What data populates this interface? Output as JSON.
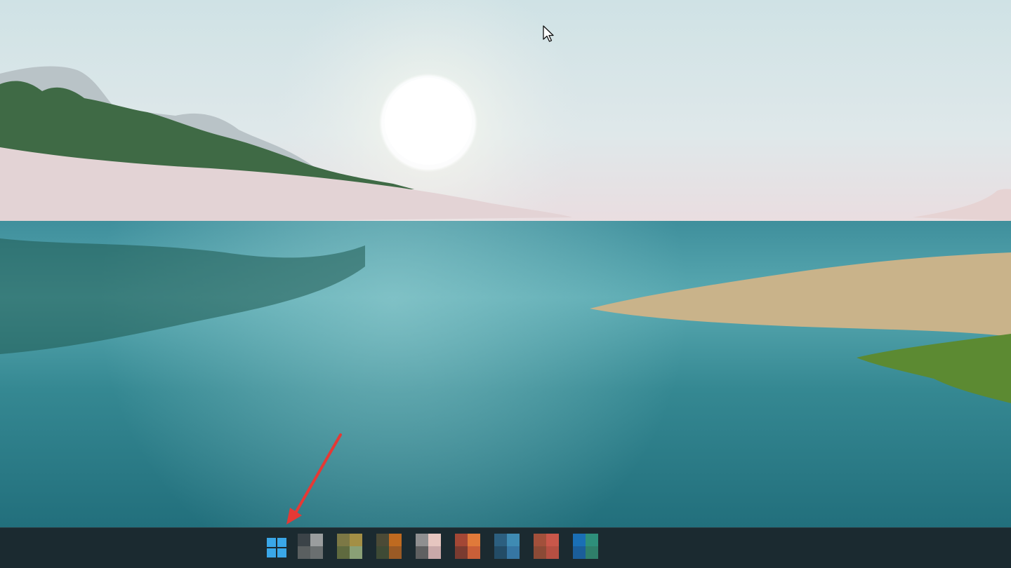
{
  "window": {
    "title": ""
  },
  "desktop": {
    "wallpaper": "lake-sunrise-wallpaper",
    "colors": {
      "sky": "#cfe3e6",
      "water": "#2f8492",
      "sun": "#ffffff",
      "grass": "#c9b38a"
    }
  },
  "taskbar": {
    "background": "#1b2a30",
    "start_icon": "windows-logo-icon",
    "start_color": "#3aa7e8",
    "apps": [
      {
        "icon": "blurred-app-icon-1",
        "colors": [
          "#3b4348",
          "#9a9d9e",
          "#5a5f60",
          "#6a6f70"
        ]
      },
      {
        "icon": "blurred-app-icon-2",
        "colors": [
          "#7c7845",
          "#a38f45",
          "#5f6a3f",
          "#8aa076"
        ]
      },
      {
        "icon": "blurred-app-icon-3",
        "colors": [
          "#4b4a36",
          "#bf6a20",
          "#3e4a35",
          "#9a5a25"
        ]
      },
      {
        "icon": "blurred-app-icon-4",
        "colors": [
          "#8f8f90",
          "#e6c6c0",
          "#5f6061",
          "#c9a9a9"
        ]
      },
      {
        "icon": "blurred-app-icon-5",
        "colors": [
          "#a34735",
          "#e07a3a",
          "#7a3b30",
          "#c95f38"
        ]
      },
      {
        "icon": "blurred-app-icon-6",
        "colors": [
          "#2c5f7f",
          "#3f8bb3",
          "#234c66",
          "#3676a3"
        ]
      },
      {
        "icon": "blurred-app-icon-7",
        "colors": [
          "#a2503b",
          "#c9574a",
          "#8b4a36",
          "#b54f42"
        ]
      },
      {
        "icon": "blurred-app-icon-8",
        "colors": [
          "#1a6fb5",
          "#2e8f7a",
          "#1b5e9a",
          "#2f7f6a"
        ]
      }
    ]
  },
  "annotation": {
    "arrow_color": "#e53935"
  }
}
